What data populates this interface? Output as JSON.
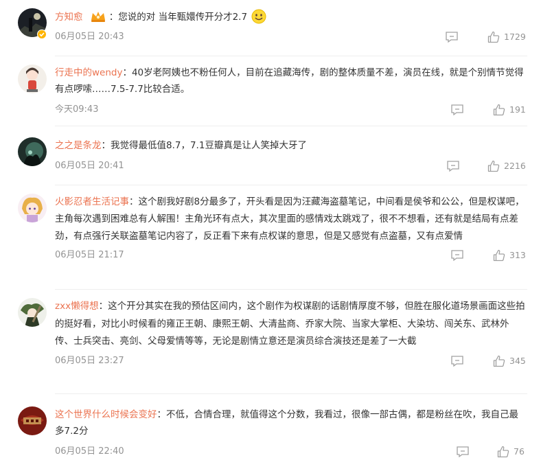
{
  "comments": [
    {
      "username": "方知愈",
      "separator": "：",
      "text": "您说的对 当年甄嬛传开分才2.7",
      "time": "06月05日 20:43",
      "likes": "1729",
      "has_crown": true,
      "has_emoji": true,
      "verified": true
    },
    {
      "username": "行走中的wendy",
      "separator": "：",
      "text": "40岁老阿姨也不粉任何人，目前在追藏海传，剧的整体质量不差，演员在线，就是个别情节觉得有点啰嗦……7.5-7.7比较合适。",
      "time": "今天09:43",
      "likes": "191"
    },
    {
      "username": "之之是条龙",
      "separator": "：",
      "text": "我觉得最低值8.7，7.1豆瓣真是让人笑掉大牙了",
      "time": "06月05日 20:41",
      "likes": "2216"
    },
    {
      "username": "火影忍者生活记事",
      "separator": "：",
      "text": "这个剧我好剧8分最多了，开头看是因为汪藏海盗墓笔记，中间看是侯爷和公公，但是权谋吧，主角每次遇到困难总有人解围！主角光环有点大，其次里面的感情戏太跳戏了，很不不想看，还有就是结局有点差劲，有点强行关联盗墓笔记内容了，反正看下来有点权谋的意思，但是又感觉有点盗墓，又有点爱情",
      "time": "06月05日 21:17",
      "likes": "313"
    },
    {
      "username": "zxx懒得想",
      "separator": "：",
      "text": "这个开分其实在我的预估区间内，这个剧作为权谋剧的话剧情厚度不够，但胜在服化道场景画面这些拍的挺好看，对比小时候看的雍正王朝、康熙王朝、大清盐商、乔家大院、当家大掌柜、大染坊、闯关东、武林外传、士兵突击、亮剑、父母爱情等等，无论是剧情立意还是演员综合演技还是差了一大截",
      "time": "06月05日 23:27",
      "likes": "345"
    },
    {
      "username": "这个世界什么时候会变好",
      "separator": "：",
      "text": "不低，合情合理，就值得这个分数，我看过，很像一部古偶，都是粉丝在吹，我自己最多7.2分",
      "time": "06月05日 22:40",
      "likes": "76"
    }
  ],
  "colors": {
    "username": "#eb7350",
    "text": "#333333",
    "meta": "#939393",
    "icon": "#a0a0a0",
    "divider": "#eeeeee"
  },
  "icons": {
    "reply": "comment-icon",
    "like": "thumbs-up-icon",
    "crown": "crown-badge-icon",
    "emoji": "smile-emoji-icon",
    "verified": "verified-badge-icon"
  }
}
